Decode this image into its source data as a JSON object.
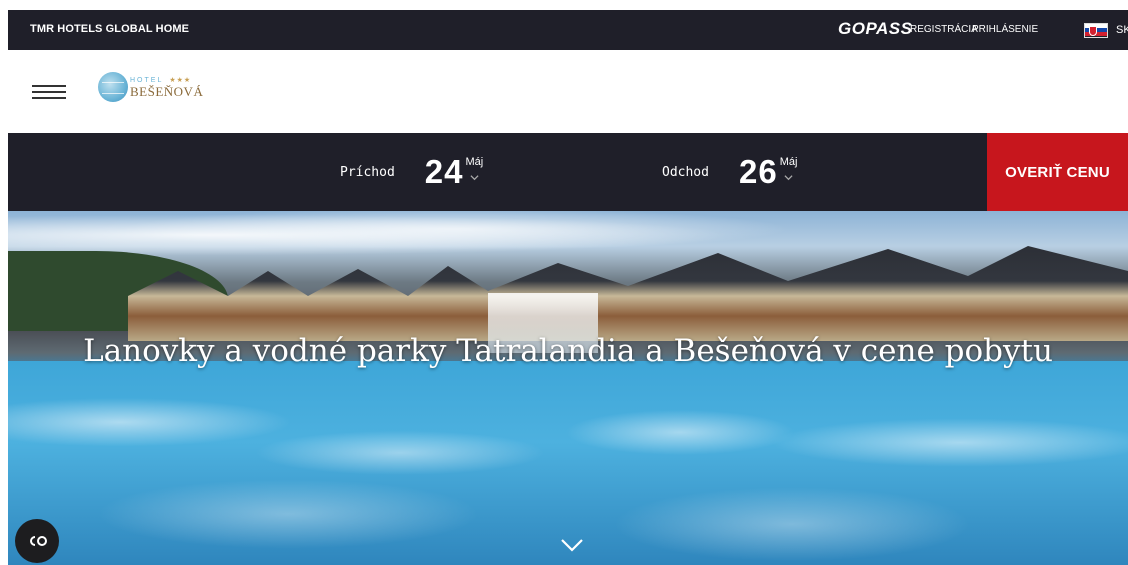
{
  "topbar": {
    "global_home": "TMR HOTELS GLOBAL HOME",
    "gopass": "GOPASS",
    "register": "REGISTRÁCIA",
    "login": "PRIHLÁSENIE",
    "language": "SK"
  },
  "header": {
    "logo": {
      "small": "HOTEL",
      "stars": "★★★",
      "name": "BEŠEŇOVÁ"
    }
  },
  "booking": {
    "arrival": {
      "label": "Príchod",
      "day": "24",
      "month": "Máj"
    },
    "departure": {
      "label": "Odchod",
      "day": "26",
      "month": "Máj"
    },
    "cta": "OVERIŤ CENU"
  },
  "hero": {
    "headline": "Lanovky a vodné parky Tatralandia a Bešeňová v cene pobytu"
  },
  "colors": {
    "dark": "#1f1f29",
    "accent": "#c7161d"
  },
  "icons": [
    "hamburger-icon",
    "flag-sk-icon",
    "chevron-down-icon",
    "cookie-consent-icon"
  ]
}
